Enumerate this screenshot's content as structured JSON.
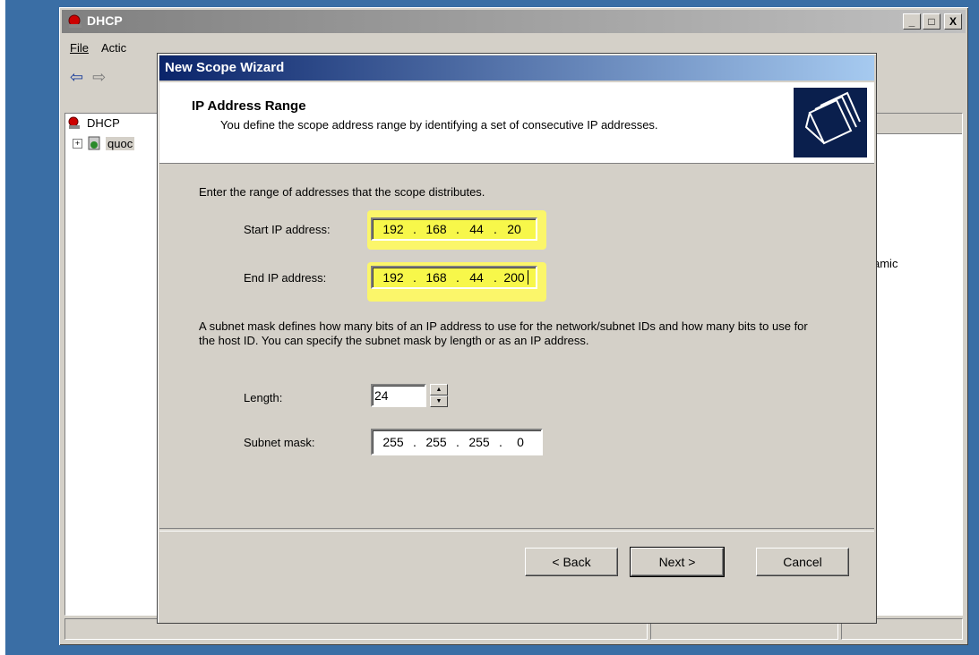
{
  "main_window": {
    "title": "DHCP",
    "caption_buttons": {
      "minimize": "_",
      "maximize": "□",
      "close": "X"
    },
    "menu": {
      "file": "File",
      "action": "Actic"
    },
    "tree": {
      "root": "DHCP",
      "server": "quoc"
    },
    "right_pane_text": "amic"
  },
  "wizard": {
    "title": "New Scope Wizard",
    "header": {
      "title": "IP Address Range",
      "subtitle": "You define the scope address range by identifying a set of consecutive IP addresses.",
      "icon": "folders-icon"
    },
    "intro": "Enter the range of addresses that the scope distributes.",
    "start_ip": {
      "label": "Start IP address:",
      "octets": [
        "192",
        "168",
        "44",
        "20"
      ]
    },
    "end_ip": {
      "label": "End IP address:",
      "octets": [
        "192",
        "168",
        "44",
        "200"
      ]
    },
    "subnet_explain": "A subnet mask defines how many bits of an IP address to use for the network/subnet IDs and how many bits to use for the host ID. You can specify the subnet mask by length or as an IP address.",
    "length": {
      "label": "Length:",
      "value": "24"
    },
    "subnet_mask": {
      "label": "Subnet mask:",
      "octets": [
        "255",
        "255",
        "255",
        "0"
      ]
    },
    "buttons": {
      "back": "< Back",
      "next": "Next >",
      "cancel": "Cancel"
    }
  },
  "colors": {
    "highlight": "#f7f74a",
    "title_active": "#0a246a",
    "face": "#d4d0c8"
  }
}
